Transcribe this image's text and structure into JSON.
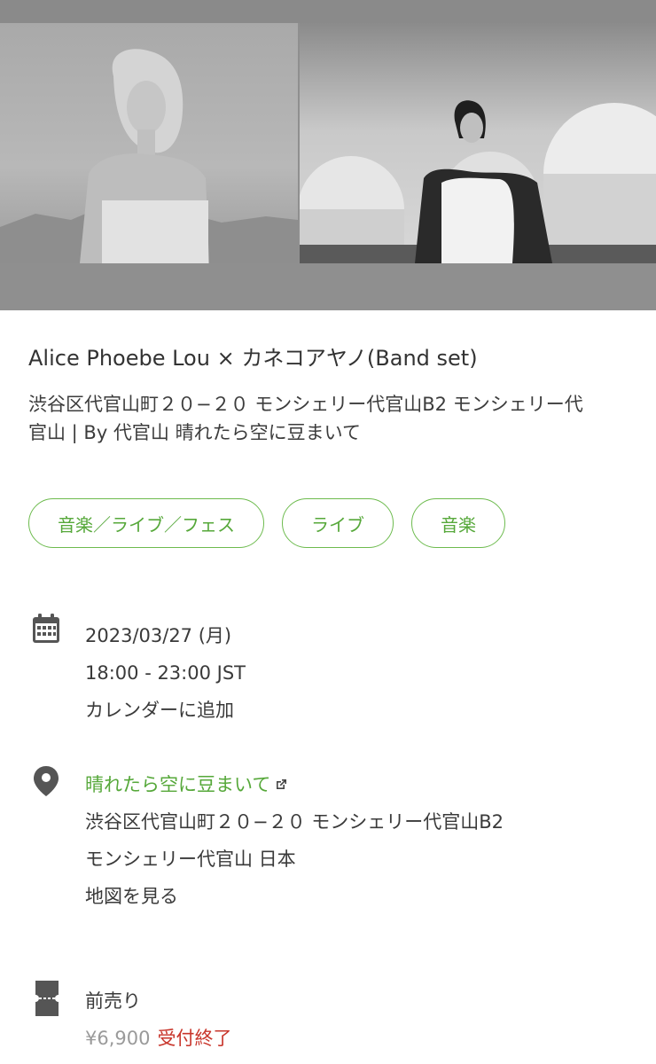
{
  "event": {
    "title": "Alice Phoebe Lou × カネコアヤノ(Band set)",
    "address_line": "渋谷区代官山町２０−２０ モンシェリー代官山B2 モンシェリー代官山 | By 代官山 晴れたら空に豆まいて"
  },
  "tags": [
    "音楽／ライブ／フェス",
    "ライブ",
    "音楽"
  ],
  "datetime": {
    "date": "2023/03/27 (月)",
    "time": "18:00 - 23:00 JST",
    "add_calendar": "カレンダーに追加"
  },
  "venue": {
    "name": "晴れたら空に豆まいて",
    "address1": "渋谷区代官山町２０−２０ モンシェリー代官山B2",
    "address2": "モンシェリー代官山 日本",
    "map_link": "地図を見る"
  },
  "ticket": {
    "name": "前売り",
    "price": "¥6,900",
    "status": "受付終了"
  },
  "colors": {
    "accent": "#56a83a",
    "closed": "#c8352b",
    "icon": "#555555"
  },
  "icons": [
    "calendar-icon",
    "map-pin-icon",
    "external-link-icon",
    "ticket-icon"
  ]
}
